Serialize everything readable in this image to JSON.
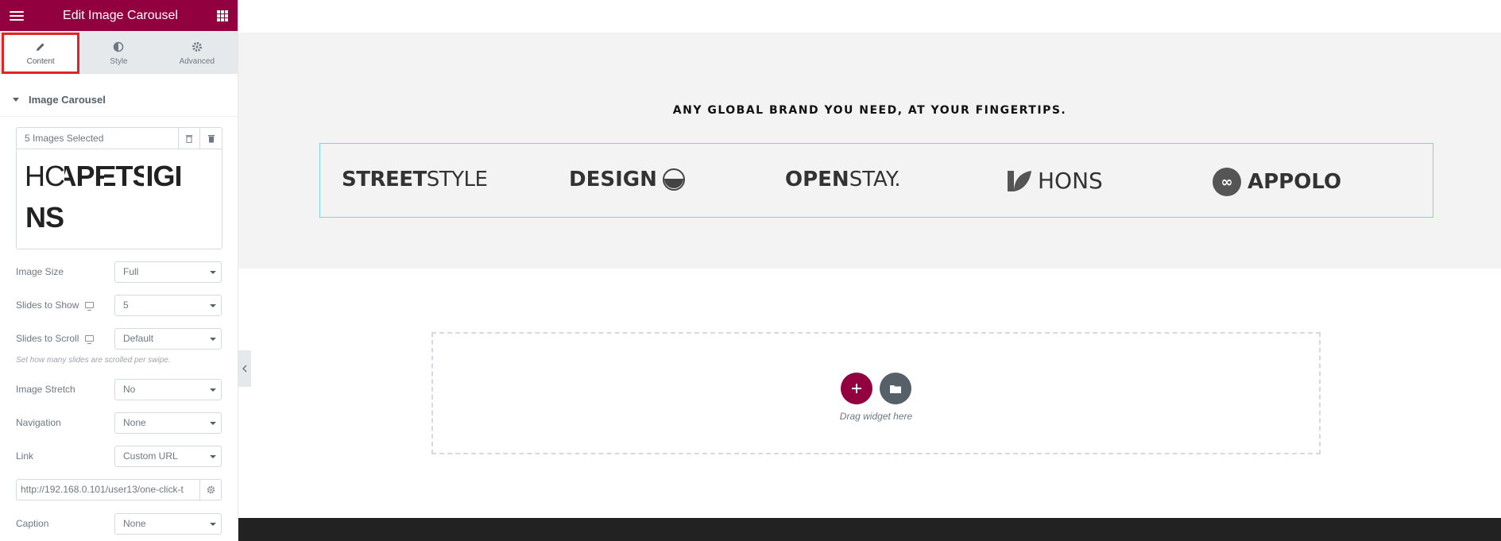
{
  "header": {
    "title": "Edit Image Carousel"
  },
  "tabs": [
    {
      "label": "Content",
      "active": true
    },
    {
      "label": "Style",
      "active": false
    },
    {
      "label": "Advanced",
      "active": false
    }
  ],
  "section": {
    "title": "Image Carousel"
  },
  "gallery": {
    "count": "5 Images Selected",
    "thumbs": [
      "HC",
      "APP",
      "ETS",
      "IGI",
      "NS"
    ]
  },
  "controls": {
    "image_size": {
      "label": "Image Size",
      "value": "Full"
    },
    "slides_to_show": {
      "label": "Slides to Show",
      "value": "5"
    },
    "slides_to_scroll": {
      "label": "Slides to Scroll",
      "value": "Default",
      "hint": "Set how many slides are scrolled per swipe."
    },
    "image_stretch": {
      "label": "Image Stretch",
      "value": "No"
    },
    "navigation": {
      "label": "Navigation",
      "value": "None"
    },
    "link": {
      "label": "Link",
      "value": "Custom URL"
    },
    "url": "http://192.168.0.101/user13/one-click-t",
    "caption": {
      "label": "Caption",
      "value": "None"
    }
  },
  "canvas": {
    "heading": "ANY GLOBAL BRAND YOU NEED, AT YOUR FINGERTIPS.",
    "logos": [
      {
        "bold": "STREET",
        "light": "STYLE"
      },
      {
        "bold": "DESIGN",
        "light": ""
      },
      {
        "bold": "OPEN",
        "light": "STAY."
      },
      {
        "bold": "",
        "light": "HONS"
      },
      {
        "bold": "APPOLO",
        "light": ""
      }
    ],
    "drop_text": "Drag widget here"
  },
  "colors": {
    "brand": "#93003f",
    "highlight": "#e52324",
    "carousel_border": "#7bd3e5"
  }
}
